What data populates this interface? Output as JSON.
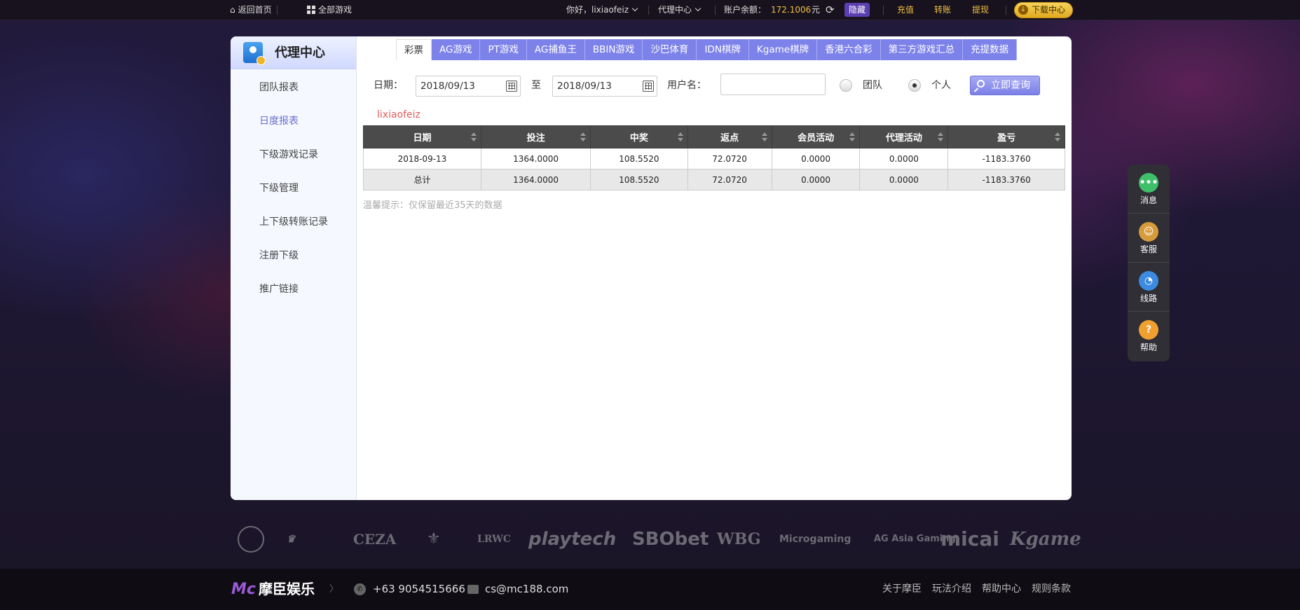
{
  "topbar": {
    "home": "返回首页",
    "all_games": "全部游戏",
    "greeting": "你好，lixiaofeiz",
    "agent_center": "代理中心",
    "balance_label": "账户余额：",
    "balance": "172.1006",
    "unit": "元",
    "hide": "隐藏",
    "deposit": "充值",
    "transfer": "转账",
    "withdraw": "提现",
    "download": "下载中心"
  },
  "sidebar": {
    "title": "代理中心",
    "items": [
      {
        "label": "团队报表"
      },
      {
        "label": "日度报表"
      },
      {
        "label": "下级游戏记录"
      },
      {
        "label": "下级管理"
      },
      {
        "label": "上下级转账记录"
      },
      {
        "label": "注册下级"
      },
      {
        "label": "推广链接"
      }
    ]
  },
  "tabs": [
    "彩票",
    "AG游戏",
    "PT游戏",
    "AG捕鱼王",
    "BBIN游戏",
    "沙巴体育",
    "IDN棋牌",
    "Kgame棋牌",
    "香港六合彩",
    "第三方游戏汇总",
    "充提数据"
  ],
  "filter": {
    "date_label": "日期：",
    "date_from": "2018/09/13",
    "to_label": "至",
    "date_to": "2018/09/13",
    "username_label": "用户名：",
    "username_value": "",
    "team_label": "团队",
    "self_label": "个人",
    "query_button": "立即查询"
  },
  "report": {
    "username": "lixiaofeiz",
    "columns": [
      "日期",
      "投注",
      "中奖",
      "返点",
      "会员活动",
      "代理活动",
      "盈亏"
    ],
    "rows": [
      [
        "2018-09-13",
        "1364.0000",
        "108.5520",
        "72.0720",
        "0.0000",
        "0.0000",
        "-1183.3760"
      ],
      [
        "总计",
        "1364.0000",
        "108.5520",
        "72.0720",
        "0.0000",
        "0.0000",
        "-1183.3760"
      ]
    ],
    "tip": "温馨提示：仅保留最近35天的数据"
  },
  "float_menu": [
    {
      "label": "消息",
      "icon": "chat-icon",
      "glyph": "•••"
    },
    {
      "label": "客服",
      "icon": "customer-service-icon",
      "glyph": "☺"
    },
    {
      "label": "线路",
      "icon": "speedometer-icon",
      "glyph": "◔"
    },
    {
      "label": "帮助",
      "icon": "help-icon",
      "glyph": "?"
    }
  ],
  "partners": [
    "CEZA",
    "playtech",
    "SBObet",
    "WBG",
    "Microgaming",
    "AG Asia Gaming",
    "micai",
    "Kgame"
  ],
  "footer": {
    "brand_mark": "Mc",
    "brand_name": "摩臣娱乐",
    "phone": "+63 9054515666",
    "email": "cs@mc188.com",
    "links": [
      "关于摩臣",
      "玩法介绍",
      "帮助中心",
      "规则条款"
    ]
  },
  "colors": {
    "accent": "#7d82ea",
    "highlight": "#f0c040",
    "username": "#e35b5b",
    "header_dark": "#4b4b4b"
  }
}
